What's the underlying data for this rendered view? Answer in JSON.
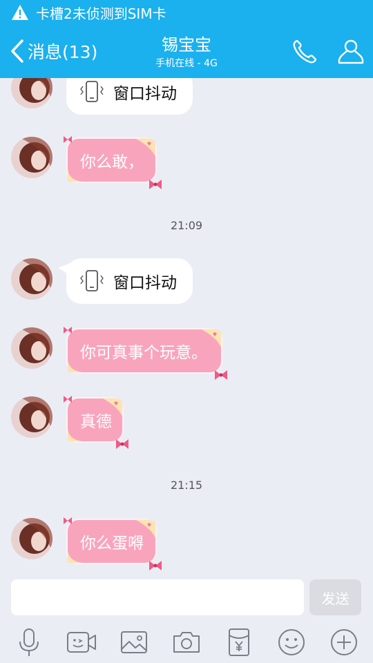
{
  "status_bar": {
    "warning_text": "卡槽2未侦测到SIM卡"
  },
  "header": {
    "back_label": "消息(13)",
    "contact_name": "锡宝宝",
    "contact_status": "手机在线 - 4G"
  },
  "messages": [
    {
      "type": "shake",
      "text": "窗口抖动"
    },
    {
      "type": "text",
      "text": "你么敢，"
    },
    {
      "type": "time",
      "text": "21:09"
    },
    {
      "type": "shake",
      "text": "窗口抖动"
    },
    {
      "type": "text",
      "text": "你可真事个玩意。"
    },
    {
      "type": "text",
      "text": "真德"
    },
    {
      "type": "time",
      "text": "21:15"
    },
    {
      "type": "text",
      "text": "你么蛋嘚"
    }
  ],
  "composer": {
    "input_value": "",
    "send_label": "发送"
  },
  "toolbar_icons": [
    "microphone-icon",
    "video-call-icon",
    "image-icon",
    "camera-icon",
    "red-packet-icon",
    "emoji-icon",
    "plus-icon"
  ],
  "colors": {
    "header_bg": "#1bb0ee",
    "bubble_pink": "#f9a4bd",
    "background": "#ebedf5"
  }
}
